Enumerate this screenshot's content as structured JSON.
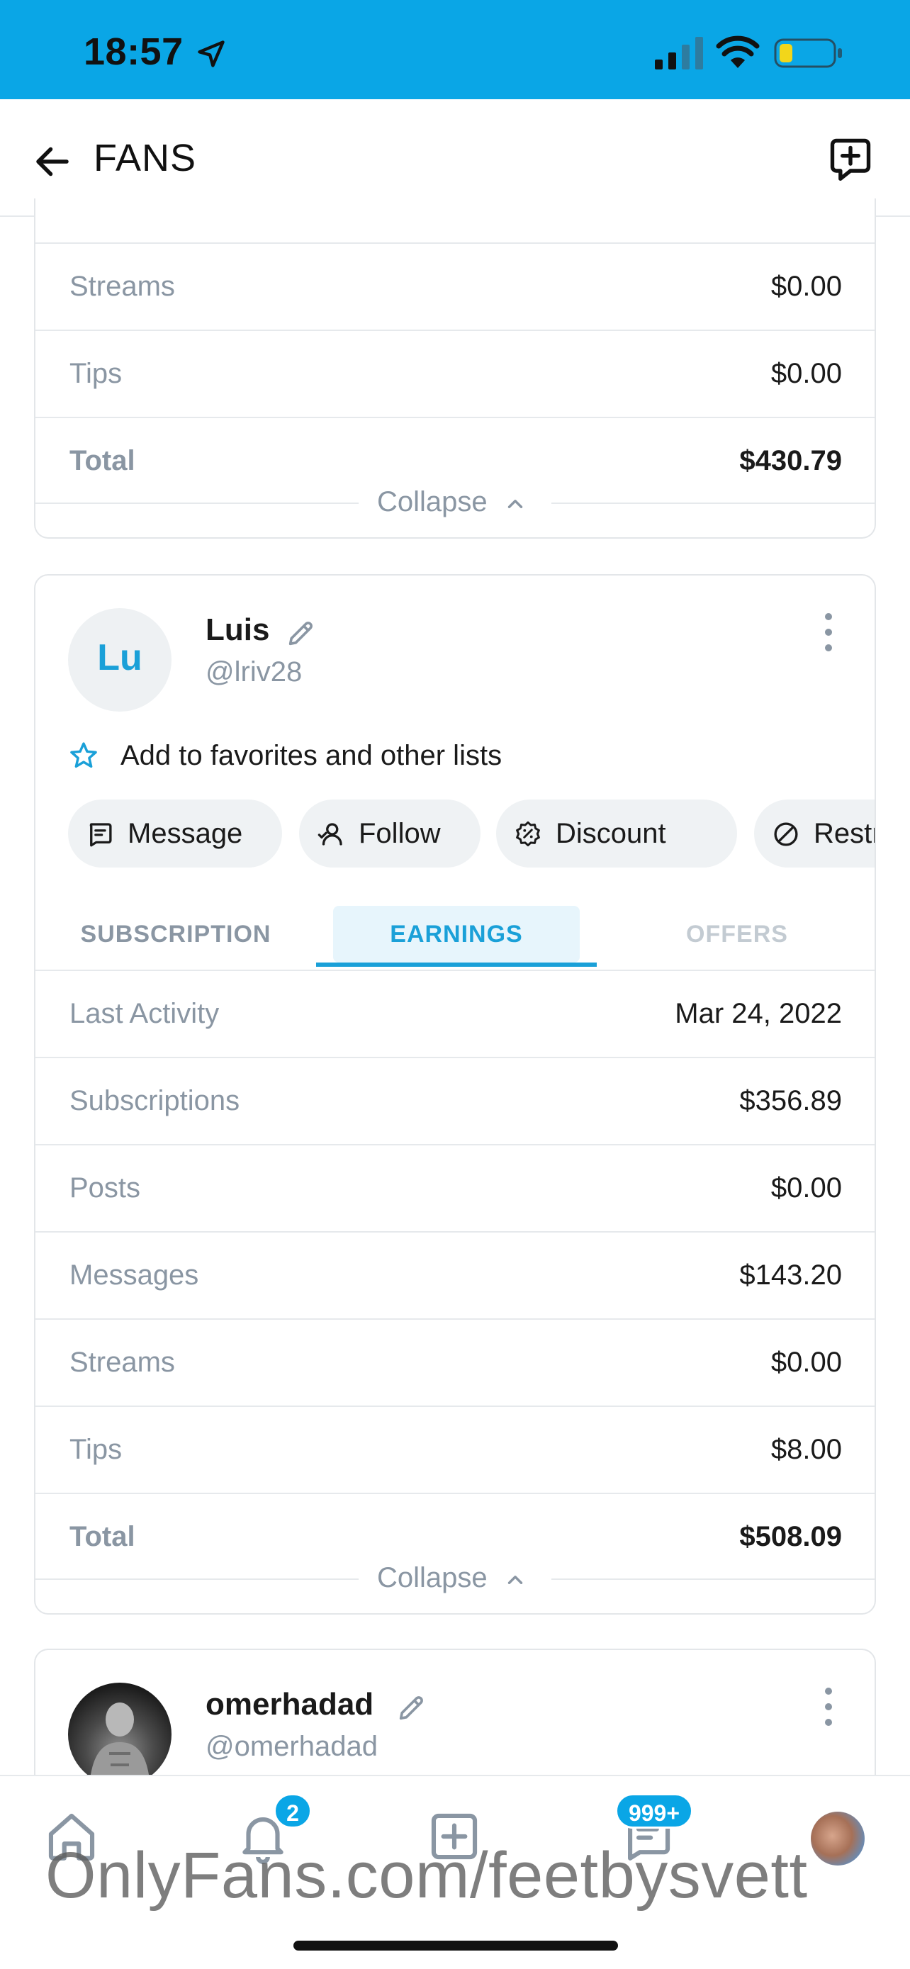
{
  "status_bar": {
    "time": "18:57"
  },
  "header": {
    "title": "FANS"
  },
  "card_top": {
    "rows": [
      {
        "label": "Streams",
        "value": "$0.00"
      },
      {
        "label": "Tips",
        "value": "$0.00"
      },
      {
        "label": "Total",
        "value": "$430.79"
      }
    ],
    "collapse_label": "Collapse"
  },
  "card_luis": {
    "avatar_initials": "Lu",
    "name": "Luis",
    "handle": "@lriv28",
    "favorites_label": "Add to favorites and other lists",
    "chips": [
      "Message",
      "Follow",
      "Discount",
      "Restrict"
    ],
    "tabs": [
      "SUBSCRIPTION",
      "EARNINGS",
      "OFFERS"
    ],
    "active_tab": "EARNINGS",
    "rows": [
      {
        "label": "Last Activity",
        "value": "Mar 24, 2022"
      },
      {
        "label": "Subscriptions",
        "value": "$356.89"
      },
      {
        "label": "Posts",
        "value": "$0.00"
      },
      {
        "label": "Messages",
        "value": "$143.20"
      },
      {
        "label": "Streams",
        "value": "$0.00"
      },
      {
        "label": "Tips",
        "value": "$8.00"
      },
      {
        "label": "Total",
        "value": "$508.09"
      }
    ],
    "collapse_label": "Collapse"
  },
  "card_omer": {
    "name": "omerhadad",
    "handle": "@omerhadad"
  },
  "bottom_nav": {
    "notifications_badge": "2",
    "messages_badge": "999+"
  },
  "watermark": "OnlyFans.com/feetbysvett",
  "colors": {
    "accent": "#0aa6e6",
    "tab_active": "#1aa0d8",
    "muted": "#8a96a3"
  }
}
